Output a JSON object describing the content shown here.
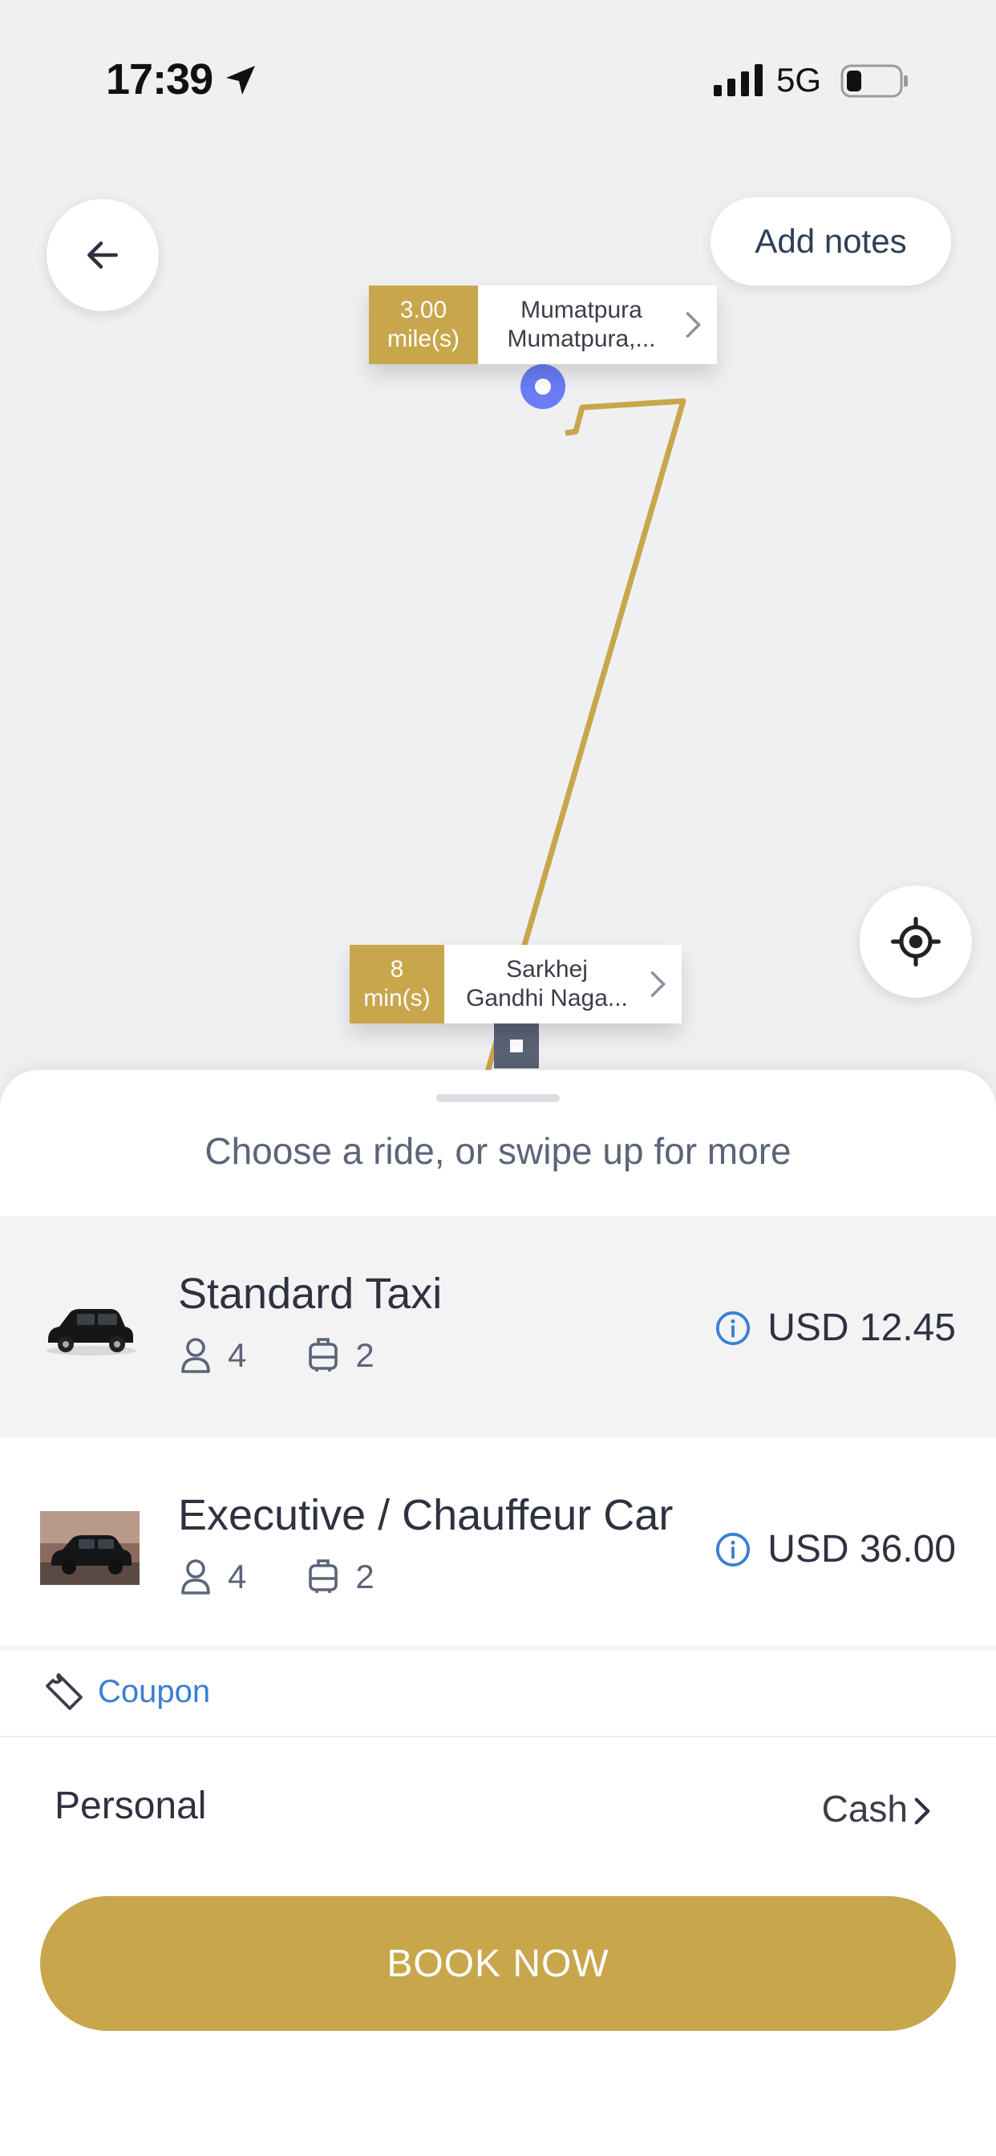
{
  "status_bar": {
    "time": "17:39",
    "network": "5G",
    "icons": [
      "location-arrow-icon",
      "signal-icon",
      "battery-icon"
    ]
  },
  "map": {
    "add_notes_label": "Add notes",
    "route_color": "#c8a64b",
    "pickup": {
      "distance_value": "3.00",
      "distance_unit": "mile(s)",
      "address_line1": "Mumatpura",
      "address_line2": "Mumatpura,..."
    },
    "dropoff": {
      "time_value": "8",
      "time_unit": "min(s)",
      "address_line1": "Sarkhej",
      "address_line2": "Gandhi Naga..."
    }
  },
  "sheet": {
    "hint": "Choose a ride, or swipe up for more",
    "rides": [
      {
        "name": "Standard Taxi",
        "passengers": "4",
        "luggage": "2",
        "price": "USD 12.45",
        "selected": true
      },
      {
        "name": "Executive / Chauffeur Car",
        "passengers": "4",
        "luggage": "2",
        "price": "USD 36.00",
        "selected": false
      }
    ],
    "coupon_label": "Coupon",
    "payment": {
      "profile": "Personal",
      "method": "Cash"
    },
    "book_label": "BOOK NOW"
  },
  "colors": {
    "accent_gold": "#c8a64b",
    "info_blue": "#3b7fd4",
    "pickup_marker": "#6b7cf6",
    "dropoff_marker": "#5a6275"
  }
}
